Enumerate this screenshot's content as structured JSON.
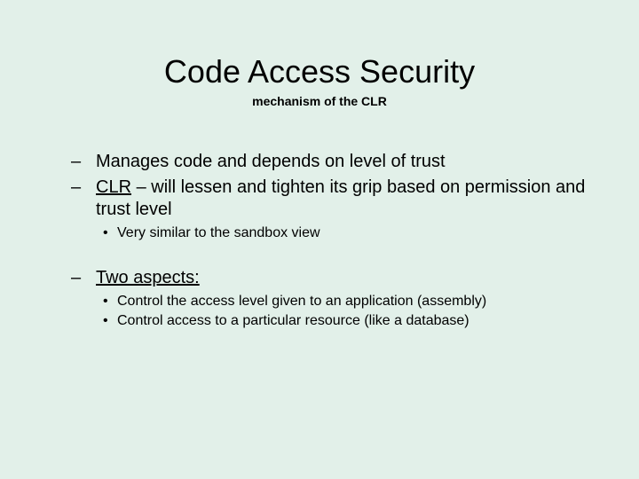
{
  "title": "Code Access Security",
  "subtitle": "mechanism of the CLR",
  "bullets": {
    "b1": "Manages code and depends on level of trust",
    "b2_term": "CLR",
    "b2_rest": " – will lessen and tighten its grip based on permission and trust level",
    "b2_sub1": "Very similar to the sandbox view",
    "b3_term": "Two aspects:",
    "b3_sub1": "Control the access level given to an application (assembly)",
    "b3_sub2": "Control access to a particular resource (like a database)"
  }
}
